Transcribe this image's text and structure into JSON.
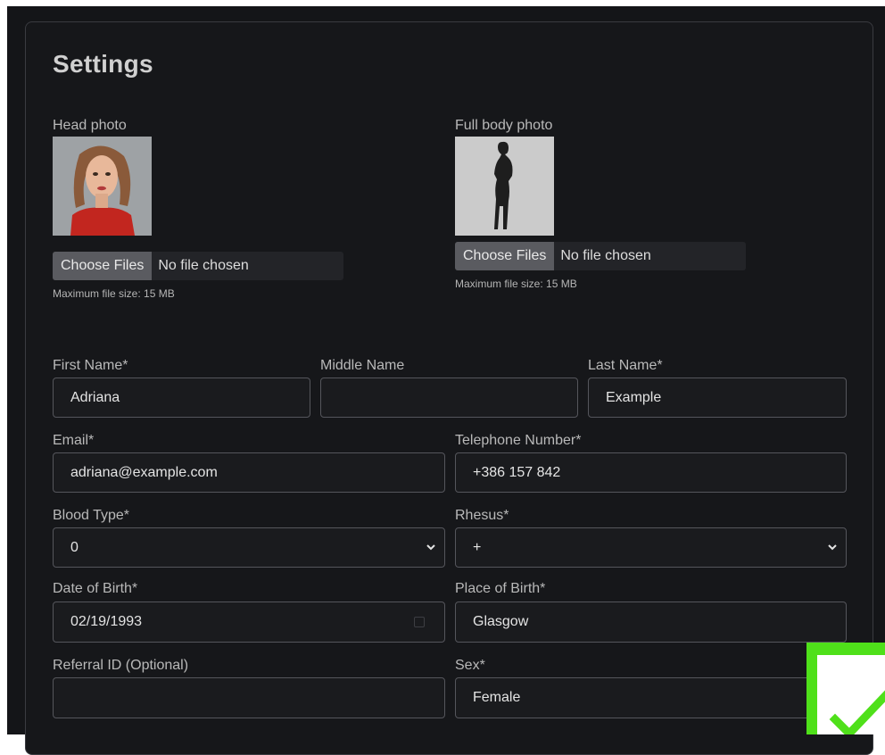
{
  "page": {
    "title": "Settings"
  },
  "head_photo": {
    "label": "Head photo",
    "button": "Choose Files",
    "file_text": "No file chosen",
    "hint": "Maximum file size: 15 MB"
  },
  "body_photo": {
    "label": "Full body photo",
    "button": "Choose Files",
    "file_text": "No file chosen",
    "hint": "Maximum file size: 15 MB"
  },
  "form": {
    "first_name": {
      "label": "First Name*",
      "value": "Adriana"
    },
    "middle_name": {
      "label": "Middle Name",
      "value": ""
    },
    "last_name": {
      "label": "Last Name*",
      "value": "Example"
    },
    "email": {
      "label": "Email*",
      "value": "adriana@example.com"
    },
    "telephone": {
      "label": "Telephone Number*",
      "value": "+386 157 842"
    },
    "blood_type": {
      "label": "Blood Type*",
      "value": "0"
    },
    "rhesus": {
      "label": "Rhesus*",
      "value": "+"
    },
    "date_of_birth": {
      "label": "Date of Birth*",
      "value": "02/19/1993"
    },
    "place_of_birth": {
      "label": "Place of Birth*",
      "value": "Glasgow"
    },
    "referral_id": {
      "label": "Referral ID (Optional)",
      "value": ""
    },
    "sex": {
      "label": "Sex*",
      "value": "Female"
    }
  },
  "colors": {
    "background": "#141518",
    "field_border": "#55565c",
    "check_green": "#4fe01a"
  },
  "icons": [
    "chevron-down-icon",
    "calendar-icon",
    "checkmark-icon",
    "silhouette-icon"
  ]
}
